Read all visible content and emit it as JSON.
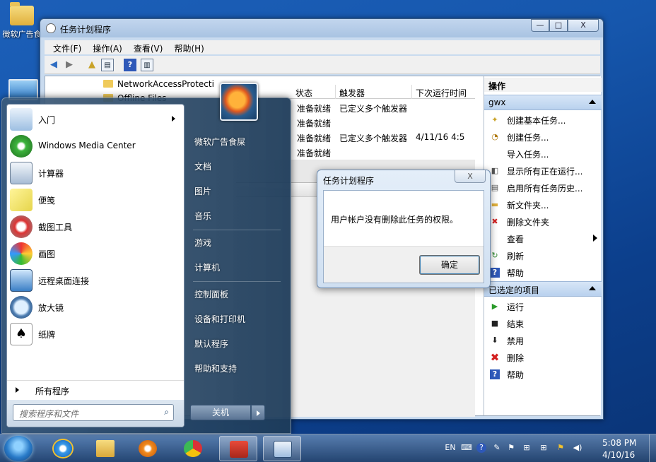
{
  "desktop": {
    "icons": [
      {
        "label": "微软广告食"
      },
      {
        "label": ""
      }
    ]
  },
  "task_window": {
    "title": "任务计划程序",
    "caption_buttons": {
      "minimize": "—",
      "maximize": "□",
      "close": "X"
    },
    "menu": [
      "文件(F)",
      "操作(A)",
      "查看(V)",
      "帮助(H)"
    ],
    "tree": [
      {
        "label": "NetworkAccessProtecti"
      },
      {
        "label": "Offline Files"
      }
    ],
    "list": {
      "columns": [
        "状态",
        "触发器",
        "下次运行时间"
      ],
      "rows": [
        {
          "status": "准备就绪",
          "trigger": "已定义多个触发器",
          "next": ""
        },
        {
          "status": "准备就绪",
          "trigger": "",
          "next": ""
        },
        {
          "status": "准备就绪",
          "trigger": "已定义多个触发器",
          "next": "4/11/16 4:5"
        },
        {
          "status": "准备就绪",
          "trigger": "",
          "next": ""
        }
      ]
    },
    "actions": {
      "pane_title": "操作",
      "group1": "gwx",
      "group1_items": [
        "创建基本任务...",
        "创建任务...",
        "导入任务...",
        "显示所有正在运行...",
        "启用所有任务历史...",
        "新文件夹...",
        "删除文件夹",
        "查看",
        "刷新",
        "帮助"
      ],
      "group2": "已选定的项目",
      "group2_items": [
        "运行",
        "结束",
        "禁用",
        "删除",
        "帮助"
      ]
    }
  },
  "dialog": {
    "title": "任务计划程序",
    "close": "X",
    "message": "用户帐户没有删除此任务的权限。",
    "ok": "确定"
  },
  "start_menu": {
    "left_items": [
      "入门",
      "Windows Media Center",
      "计算器",
      "便笺",
      "截图工具",
      "画图",
      "远程桌面连接",
      "放大镜",
      "纸牌"
    ],
    "all_programs": "所有程序",
    "search_placeholder": "搜索程序和文件",
    "right_items": [
      "微软广告食屎",
      "文档",
      "图片",
      "音乐",
      "游戏",
      "计算机",
      "控制面板",
      "设备和打印机",
      "默认程序",
      "帮助和支持"
    ],
    "shutdown": "关机"
  },
  "taskbar": {
    "tray_lang": "EN",
    "time": "5:08 PM",
    "date": "4/10/16"
  },
  "colors": {
    "desktop": "#1657ad",
    "group_header": "#c7dbf2",
    "error_red": "#d32020"
  }
}
